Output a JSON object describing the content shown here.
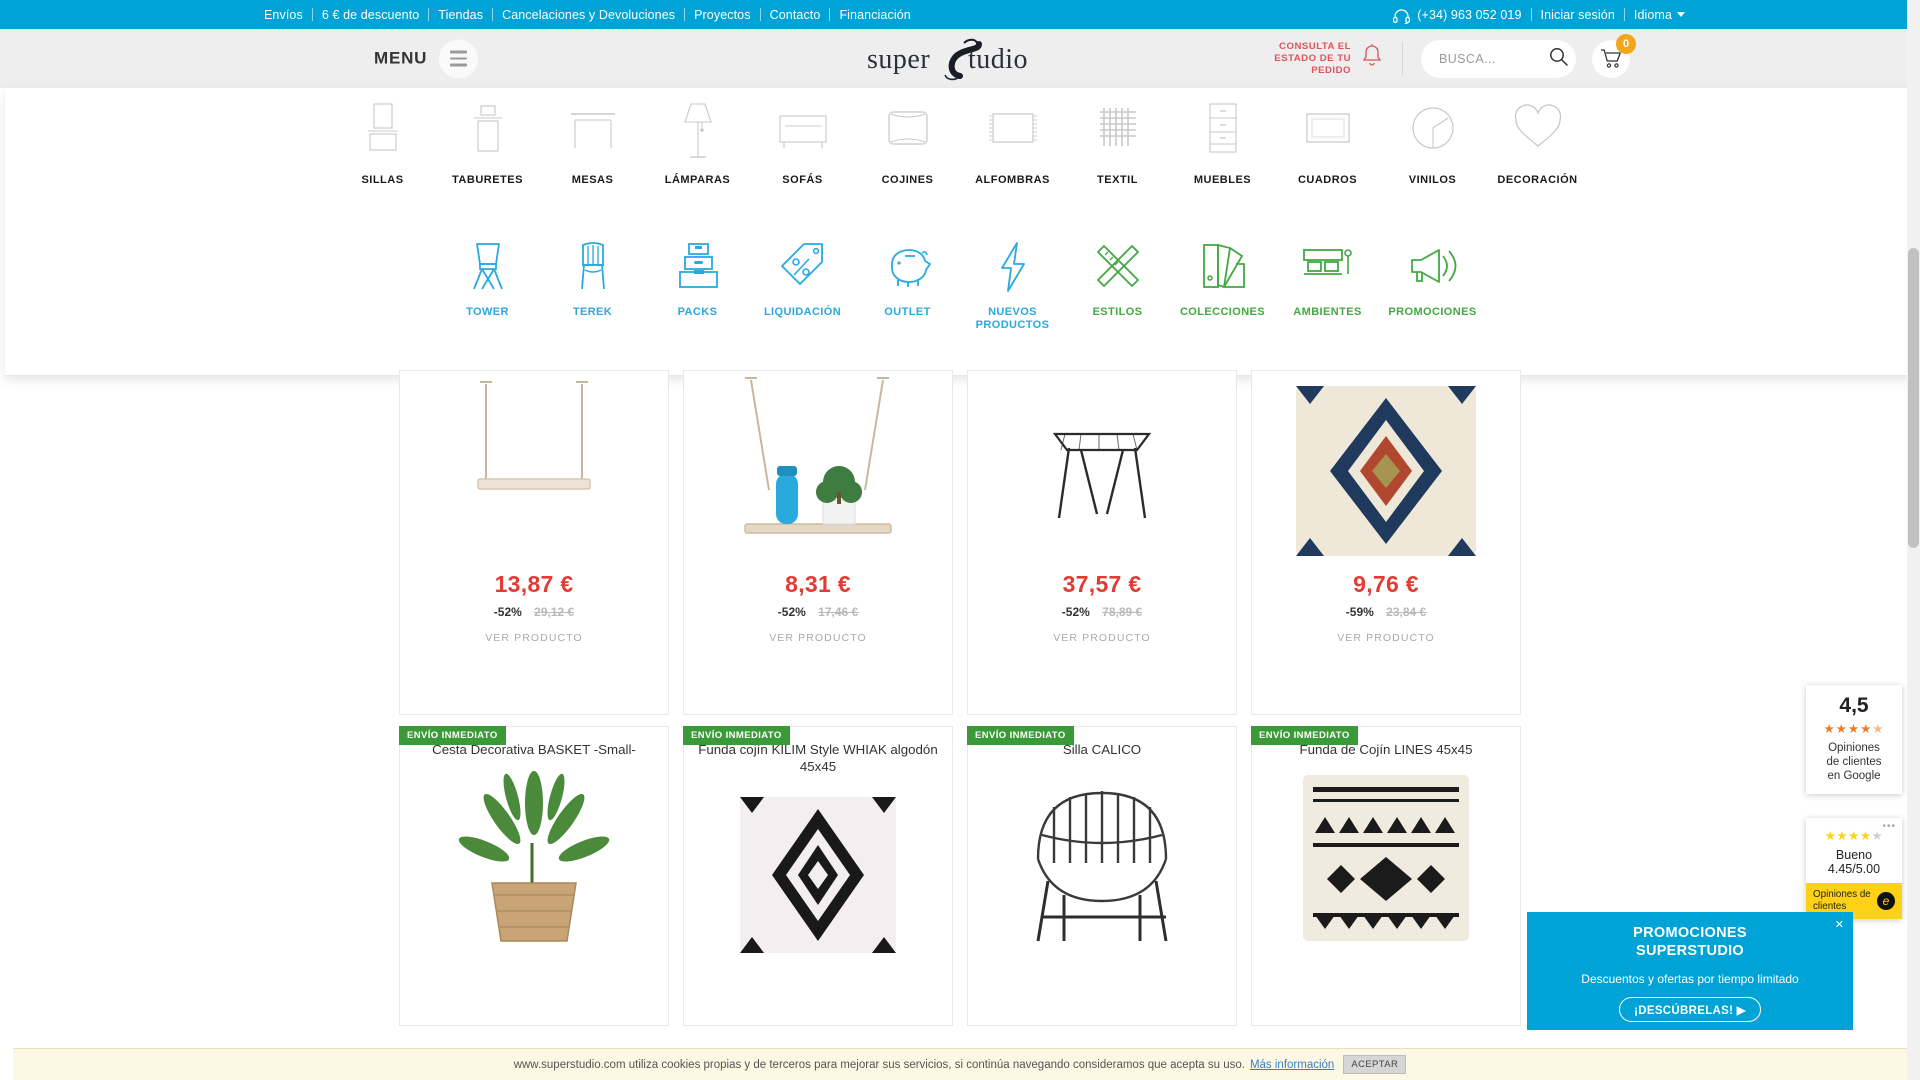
{
  "topbar": {
    "links": [
      "Envíos",
      "6 € de descuento",
      "Tiendas",
      "Cancelaciones y Devoluciones",
      "Proyectos",
      "Contacto",
      "Financiación"
    ],
    "phone": "(+34) 963 052 019",
    "login": "Iniciar sesión",
    "language": "Idioma",
    "bg_color": "#00a3d6"
  },
  "header": {
    "menu_label": "MENU",
    "logo_text": "superstudio",
    "order_status": "CONSULTA EL ESTADO DE TU PEDIDO",
    "order_status_l1": "CONSULTA EL",
    "order_status_l2": "ESTADO DE TU",
    "order_status_l3": "PEDIDO",
    "search_placeholder": "BUSCA...",
    "search_value": "",
    "cart_count": "0",
    "accent_red": "#e0525a",
    "cart_badge_color": "#f2a71b"
  },
  "mega_menu": {
    "categories": [
      {
        "label": "SILLAS",
        "icon": "chair-icon"
      },
      {
        "label": "TABURETES",
        "icon": "stool-icon"
      },
      {
        "label": "MESAS",
        "icon": "table-icon"
      },
      {
        "label": "LÁMPARAS",
        "icon": "lamp-icon"
      },
      {
        "label": "SOFÁS",
        "icon": "sofa-icon"
      },
      {
        "label": "COJINES",
        "icon": "cushion-icon"
      },
      {
        "label": "ALFOMBRAS",
        "icon": "rug-icon"
      },
      {
        "label": "TEXTIL",
        "icon": "textile-icon"
      },
      {
        "label": "MUEBLES",
        "icon": "furniture-icon"
      },
      {
        "label": "CUADROS",
        "icon": "frame-icon"
      },
      {
        "label": "VINILOS",
        "icon": "vinyl-icon"
      },
      {
        "label": "DECORACIÓN",
        "icon": "heart-icon"
      }
    ],
    "promos": [
      {
        "label": "TOWER",
        "icon": "tower-chair-icon",
        "color": "#29a9e0"
      },
      {
        "label": "TEREK",
        "icon": "terek-chair-icon",
        "color": "#29a9e0"
      },
      {
        "label": "PACKS",
        "icon": "boxes-icon",
        "color": "#29a9e0"
      },
      {
        "label": "LIQUIDACIÓN",
        "icon": "price-tag-icon",
        "color": "#29a9e0"
      },
      {
        "label": "OUTLET",
        "icon": "piggy-bank-icon",
        "color": "#29a9e0"
      },
      {
        "label": "NUEVOS PRODUCTOS",
        "icon": "lightning-bolt-icon",
        "color": "#29a9e0"
      },
      {
        "label": "ESTILOS",
        "icon": "pencil-ruler-icon",
        "color": "#43a843"
      },
      {
        "label": "COLECCIONES",
        "icon": "color-samples-icon",
        "color": "#43a843"
      },
      {
        "label": "AMBIENTES",
        "icon": "room-scene-icon",
        "color": "#43a843"
      },
      {
        "label": "PROMOCIONES",
        "icon": "megaphone-icon",
        "color": "#43a843"
      }
    ]
  },
  "products_row1": [
    {
      "price": "13,87 €",
      "discount": "-52%",
      "old_price": "29,12 €",
      "cta": "VER PRODUCTO",
      "image": "hanging-shelf-rope"
    },
    {
      "price": "8,31 €",
      "discount": "-52%",
      "old_price": "17,46 €",
      "cta": "VER PRODUCTO",
      "image": "hanging-shelf-plant"
    },
    {
      "price": "37,57 €",
      "discount": "-52%",
      "old_price": "78,89 €",
      "cta": "VER PRODUCTO",
      "image": "black-metal-stool"
    },
    {
      "price": "9,76 €",
      "discount": "-59%",
      "old_price": "23,84 €",
      "cta": "VER PRODUCTO",
      "image": "kilim-cushion"
    }
  ],
  "products_row2": [
    {
      "badge": "ENVÍO INMEDIATO",
      "title": "Cesta Decorativa BASKET -Small-",
      "image": "basket-plant"
    },
    {
      "badge": "ENVÍO INMEDIATO",
      "title": "Funda cojín KILIM Style WHIAK algodón 45x45",
      "image": "kilim-white-cushion"
    },
    {
      "badge": "ENVÍO INMEDIATO",
      "title": "Silla CALICO",
      "image": "calico-chair"
    },
    {
      "badge": "ENVÍO INMEDIATO",
      "title": "Funda de Cojín LINES 45x45",
      "image": "lines-cushion"
    }
  ],
  "google_widget": {
    "score": "4,5",
    "stars": "★★★★",
    "line1": "Opiniones",
    "line2": "de clientes",
    "line3": "en Google"
  },
  "ekomi_widget": {
    "stars": "★★★★",
    "rating_label": "Bueno",
    "rating_value": "4.45/5.00",
    "footer_l1": "Opiniones de",
    "footer_l2": "clientes",
    "dots": "•••"
  },
  "promo_banner": {
    "title_l1": "PROMOCIONES",
    "title_l2": "SUPERSTUDIO",
    "subtitle": "Descuentos y ofertas por tiempo limitado",
    "button": "¡DESCÚBRELAS! ▶",
    "close": "✕",
    "bg_color": "#00a3d6"
  },
  "cookie_bar": {
    "text": "www.superstudio.com utiliza cookies propias y de terceros para mejorar sus servicios, si continúa navegando consideramos que acepta su uso.",
    "link": "Más información",
    "button": "ACEPTAR"
  }
}
